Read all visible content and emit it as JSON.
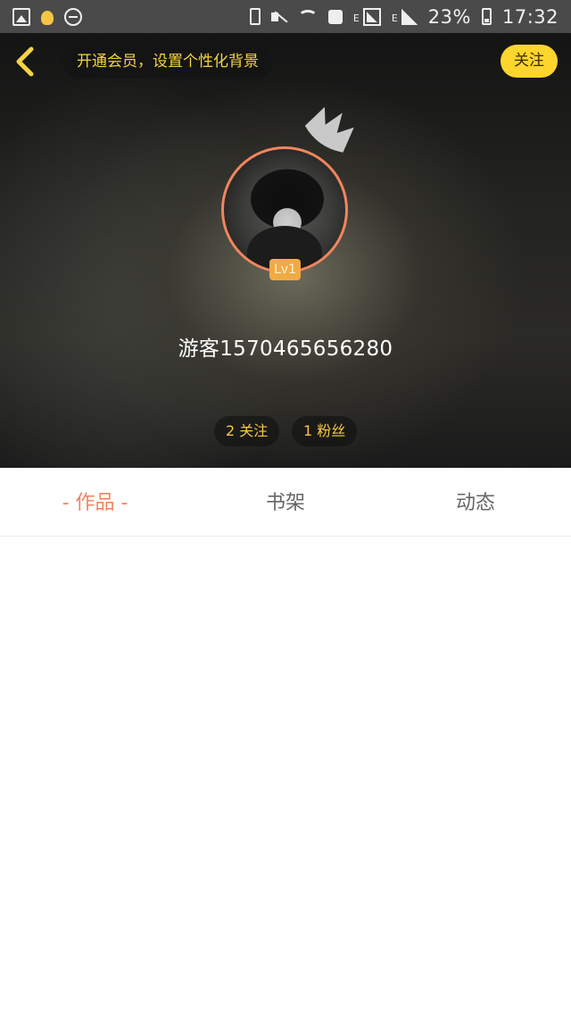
{
  "status_bar": {
    "left_icons": [
      "image-icon",
      "bulb-icon",
      "minus-circle-icon"
    ],
    "right_icons": [
      "battery-saver-icon",
      "mute-icon",
      "wifi-icon",
      "message-icon",
      "signal-box-icon",
      "signal-icon",
      "battery-icon"
    ],
    "network_label_1": "E",
    "network_label_2": "E",
    "battery_percent": "23%",
    "time": "17:32"
  },
  "header": {
    "back_icon": "chevron-left-icon",
    "vip_banner": "开通会员，设置个性化背景",
    "follow_button": "关注"
  },
  "profile": {
    "avatar_decoration": "crown-icon",
    "level_badge": "Lv1",
    "username": "游客1570465656280",
    "following": "2 关注",
    "fans": "1 粉丝"
  },
  "tabs": {
    "works": "- 作品 -",
    "bookshelf": "书架",
    "activity": "动态",
    "active": "works"
  },
  "colors": {
    "accent": "#f0855f",
    "follow_button": "#fed52c",
    "stat_text": "#f5c842",
    "level_badge": "#f2aa43",
    "status_bar": "#4a4a4a"
  }
}
